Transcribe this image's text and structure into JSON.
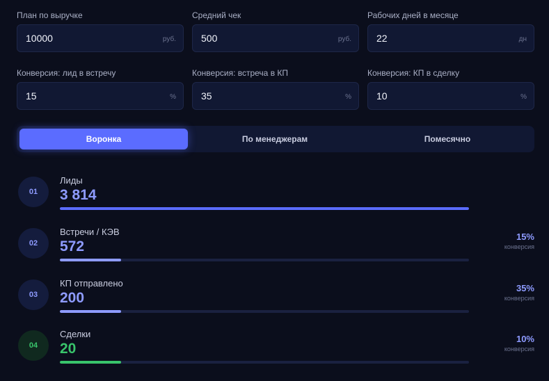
{
  "inputs": [
    {
      "label": "План по выручке",
      "value": "10000",
      "unit": "руб."
    },
    {
      "label": "Средний чек",
      "value": "500",
      "unit": "руб."
    },
    {
      "label": "Рабочих дней в месяце",
      "value": "22",
      "unit": "дн"
    },
    {
      "label": "Конверсия: лид в встречу",
      "value": "15",
      "unit": "%"
    },
    {
      "label": "Конверсия: встреча в КП",
      "value": "35",
      "unit": "%"
    },
    {
      "label": "Конверсия: КП в сделку",
      "value": "10",
      "unit": "%"
    }
  ],
  "tabs": [
    {
      "label": "Воронка",
      "active": true
    },
    {
      "label": "По менеджерам",
      "active": false
    },
    {
      "label": "Помесячно",
      "active": false
    }
  ],
  "funnel": [
    {
      "number": "01",
      "title": "Лиды",
      "value": "3 814",
      "fill": 1.0
    },
    {
      "number": "02",
      "title": "Встречи / КЭВ",
      "value": "572",
      "fill": 0.15,
      "rate": "15%",
      "rate_label": "конверсия"
    },
    {
      "number": "03",
      "title": "КП отправлено",
      "value": "200",
      "fill": 0.15,
      "rate": "35%",
      "rate_label": "конверсия"
    },
    {
      "number": "04",
      "title": "Сделки",
      "value": "20",
      "fill": 0.15,
      "rate": "10%",
      "rate_label": "конверсия"
    }
  ],
  "colors": {
    "accent": "#5b6cff",
    "accent_light": "#8e9bff",
    "success": "#39c46b",
    "background": "#0b0e1c"
  }
}
